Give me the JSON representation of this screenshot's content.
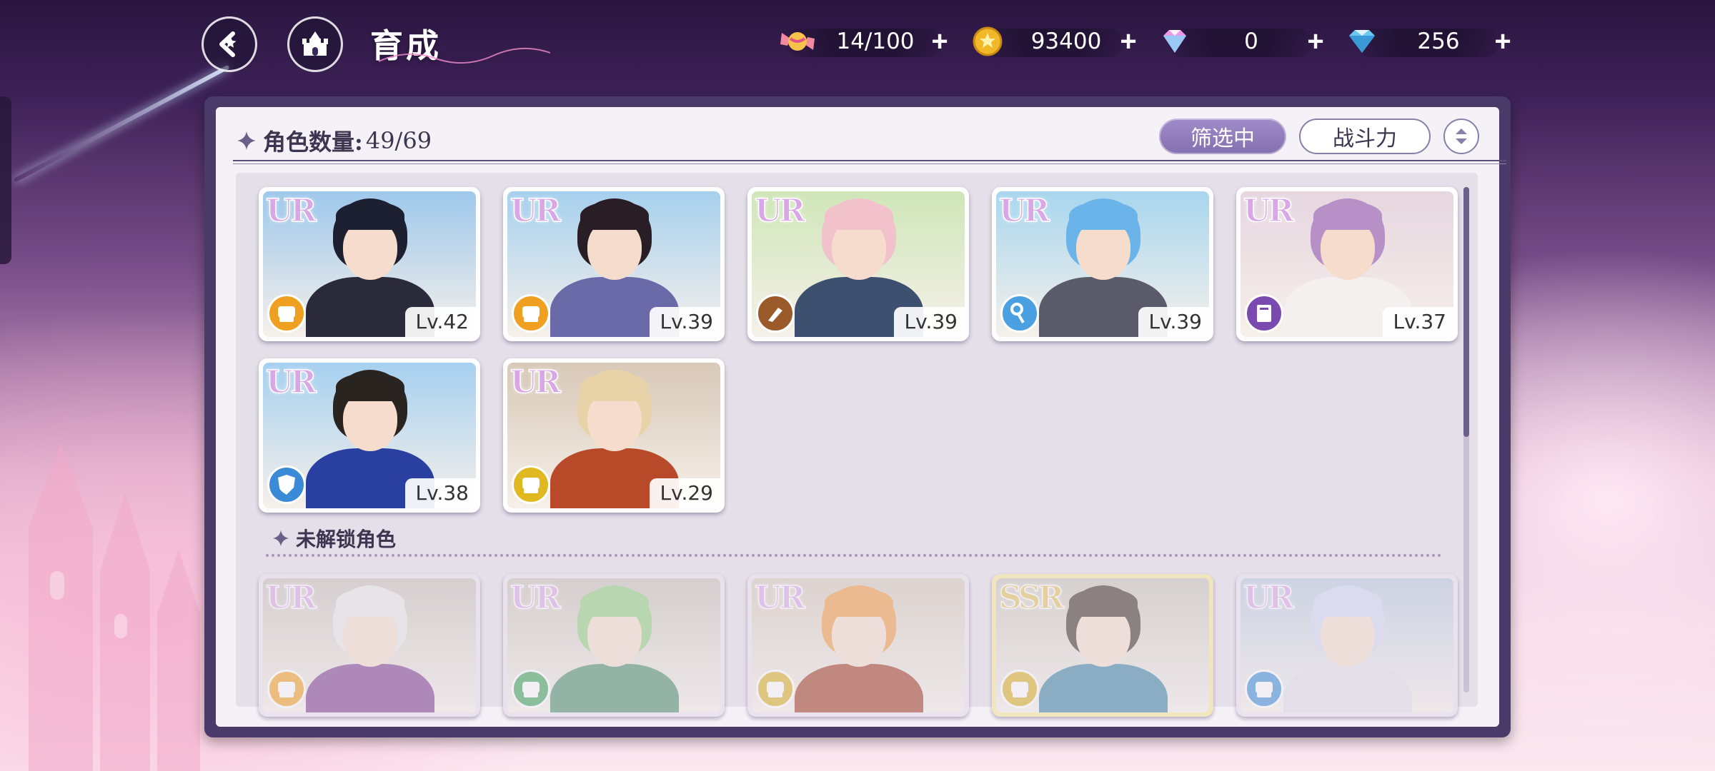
{
  "header": {
    "title": "育成"
  },
  "currencies": [
    {
      "name": "candy",
      "icon": "candy-icon",
      "value": "14/100"
    },
    {
      "name": "coin",
      "icon": "coin-icon",
      "value": "93400"
    },
    {
      "name": "pink-gem",
      "icon": "pink-gem-icon",
      "value": "0"
    },
    {
      "name": "blue-gem",
      "icon": "blue-diamond-icon",
      "value": "256"
    }
  ],
  "panel": {
    "count_label": "角色数量:",
    "count_value": "49/69",
    "filter_label": "筛选中",
    "sort_label": "战斗力"
  },
  "owned_characters": [
    {
      "rarity": "UR",
      "level": "Lv.42",
      "type": "fist",
      "type_color": "#f0a020",
      "hair": "#1d2030",
      "sky": "#9ec8ec",
      "outfit": "#2a2a3a"
    },
    {
      "rarity": "UR",
      "level": "Lv.39",
      "type": "fist",
      "type_color": "#f0a020",
      "hair": "#2a1e26",
      "sky": "#a6d0ee",
      "outfit": "#6a6aa8"
    },
    {
      "rarity": "UR",
      "level": "Lv.39",
      "type": "brush",
      "type_color": "#9a5a2a",
      "hair": "#f2c2cc",
      "sky": "#cfe6b8",
      "outfit": "#3d5070"
    },
    {
      "rarity": "UR",
      "level": "Lv.39",
      "type": "key",
      "type_color": "#4aa0e0",
      "hair": "#6ab4ea",
      "sky": "#a8d6ee",
      "outfit": "#5a5a6a"
    },
    {
      "rarity": "UR",
      "level": "Lv.37",
      "type": "book",
      "type_color": "#7a4ab0",
      "hair": "#b890c8",
      "sky": "#e6d6e0",
      "outfit": "#f4f0f0"
    },
    {
      "rarity": "UR",
      "level": "Lv.38",
      "type": "shield",
      "type_color": "#3a8ad8",
      "hair": "#2a2420",
      "sky": "#a6d0f0",
      "outfit": "#2a40a0"
    },
    {
      "rarity": "UR",
      "level": "Lv.29",
      "type": "fist",
      "type_color": "#e0b820",
      "hair": "#e8d2a8",
      "sky": "#d8c8b8",
      "outfit": "#b84a2a"
    }
  ],
  "locked_section": {
    "label": "未解锁角色"
  },
  "locked_characters": [
    {
      "rarity": "UR",
      "type_color": "#f0a020",
      "hair": "#e8e8ea",
      "sky": "#c8c0b8",
      "outfit": "#7a3a8a"
    },
    {
      "rarity": "UR",
      "type_color": "#3aa050",
      "hair": "#8ed07a",
      "sky": "#c8c0b4",
      "outfit": "#4a8a6a"
    },
    {
      "rarity": "UR",
      "type_color": "#d8b020",
      "hair": "#f09a40",
      "sky": "#d4c8b8",
      "outfit": "#a03a20"
    },
    {
      "rarity": "SSR",
      "type_color": "#d8b020",
      "hair": "#3a2a22",
      "sky": "#c8c4b8",
      "outfit": "#3a80a0"
    },
    {
      "rarity": "UR",
      "type_color": "#3a8ad8",
      "hair": "#d0d8ee",
      "sky": "#b8c8dc",
      "outfit": "#e0e0ea"
    }
  ]
}
